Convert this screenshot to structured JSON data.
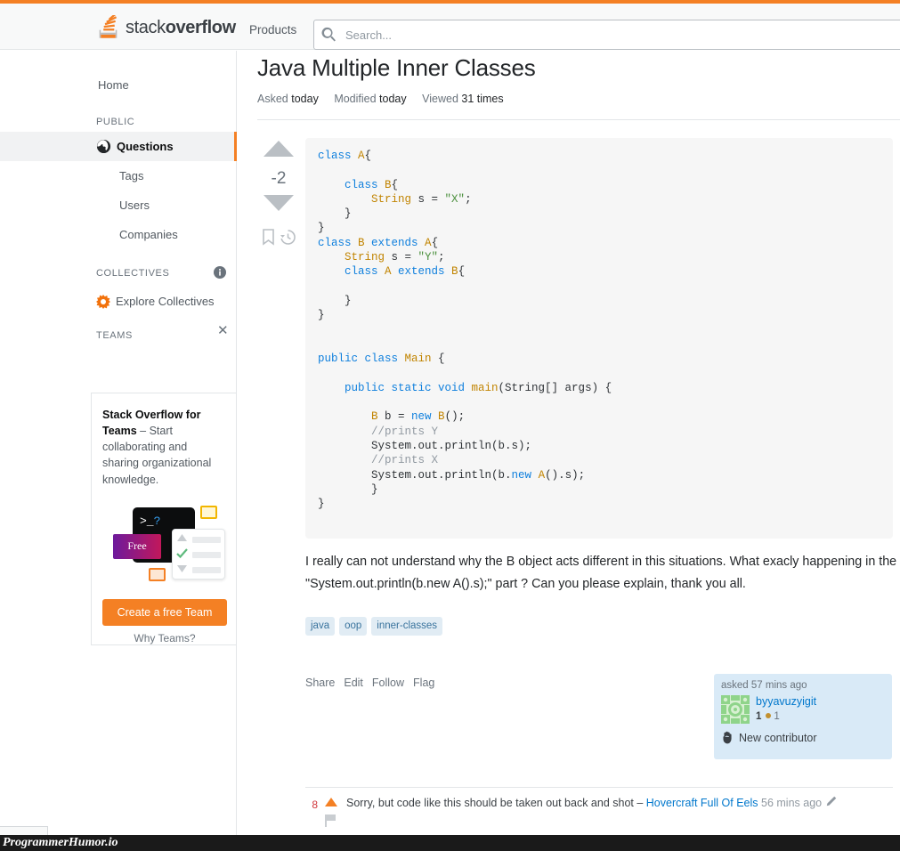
{
  "theme": {
    "accent": "#f48024",
    "link": "#0077cc",
    "tag_bg": "#e1ecf4",
    "tag_fg": "#39739d",
    "usercard_bg": "#d9eaf7",
    "code_bg": "#f6f6f6"
  },
  "header": {
    "logo_text_light": "stack",
    "logo_text_bold": "overflow",
    "products_label": "Products",
    "search": {
      "placeholder": "Search...",
      "value": ""
    }
  },
  "sidebar": {
    "home_label": "Home",
    "public_heading": "PUBLIC",
    "items": [
      {
        "label": "Questions",
        "active": true
      },
      {
        "label": "Tags",
        "active": false
      },
      {
        "label": "Users",
        "active": false
      },
      {
        "label": "Companies",
        "active": false
      }
    ],
    "collectives_heading": "COLLECTIVES",
    "collectives_label": "Explore Collectives",
    "teams_heading": "TEAMS",
    "teams_card": {
      "title": "Stack Overflow for Teams",
      "body": " – Start collaborating and sharing organizational knowledge.",
      "art_prompt": ">_",
      "art_question": "?",
      "art_free_label": "Free",
      "cta_label": "Create a free Team",
      "why_label": "Why Teams?"
    }
  },
  "question": {
    "title": "Java Multiple Inner Classes",
    "meta": {
      "asked_label": "Asked",
      "asked_value": "today",
      "modified_label": "Modified",
      "modified_value": "today",
      "viewed_label": "Viewed",
      "viewed_value": "31 times"
    },
    "votes": "-2",
    "code_lines": [
      [
        {
          "t": "class ",
          "c": "k"
        },
        {
          "t": "A",
          "c": "t"
        },
        {
          "t": "{",
          "c": "p"
        }
      ],
      [],
      [
        {
          "t": "    class ",
          "c": "k"
        },
        {
          "t": "B",
          "c": "t"
        },
        {
          "t": "{",
          "c": "p"
        }
      ],
      [
        {
          "t": "        String",
          "c": "t"
        },
        {
          "t": " s = ",
          "c": "p"
        },
        {
          "t": "\"X\"",
          "c": "s"
        },
        {
          "t": ";",
          "c": "p"
        }
      ],
      [
        {
          "t": "    }",
          "c": "p"
        }
      ],
      [
        {
          "t": "}",
          "c": "p"
        }
      ],
      [
        {
          "t": "class ",
          "c": "k"
        },
        {
          "t": "B",
          "c": "t"
        },
        {
          "t": " extends ",
          "c": "k"
        },
        {
          "t": "A",
          "c": "t"
        },
        {
          "t": "{",
          "c": "p"
        }
      ],
      [
        {
          "t": "    String",
          "c": "t"
        },
        {
          "t": " s = ",
          "c": "p"
        },
        {
          "t": "\"Y\"",
          "c": "s"
        },
        {
          "t": ";",
          "c": "p"
        }
      ],
      [
        {
          "t": "    class ",
          "c": "k"
        },
        {
          "t": "A",
          "c": "t"
        },
        {
          "t": " extends ",
          "c": "k"
        },
        {
          "t": "B",
          "c": "t"
        },
        {
          "t": "{",
          "c": "p"
        }
      ],
      [],
      [
        {
          "t": "    }",
          "c": "p"
        }
      ],
      [
        {
          "t": "}",
          "c": "p"
        }
      ],
      [],
      [],
      [
        {
          "t": "public class ",
          "c": "k"
        },
        {
          "t": "Main",
          "c": "t"
        },
        {
          "t": " {",
          "c": "p"
        }
      ],
      [],
      [
        {
          "t": "    public static void ",
          "c": "k"
        },
        {
          "t": "main",
          "c": "t"
        },
        {
          "t": "(String[] args) {",
          "c": "p"
        }
      ],
      [],
      [
        {
          "t": "        B",
          "c": "t"
        },
        {
          "t": " b = ",
          "c": "p"
        },
        {
          "t": "new ",
          "c": "k"
        },
        {
          "t": "B",
          "c": "t"
        },
        {
          "t": "();",
          "c": "p"
        }
      ],
      [
        {
          "t": "        //prints Y",
          "c": "c"
        }
      ],
      [
        {
          "t": "        System.out.println(b.s);",
          "c": "p"
        }
      ],
      [
        {
          "t": "        //prints X",
          "c": "c"
        }
      ],
      [
        {
          "t": "        System.out.println(b.",
          "c": "p"
        },
        {
          "t": "new ",
          "c": "k"
        },
        {
          "t": "A",
          "c": "t"
        },
        {
          "t": "().s);",
          "c": "p"
        }
      ],
      [
        {
          "t": "        }",
          "c": "p"
        }
      ],
      [
        {
          "t": "}",
          "c": "p"
        }
      ]
    ],
    "body": "I really can not understand why the B object acts different in this situations. What exacly happening in the \"System.out.println(b.new A().s);\" part ? Can you please explain, thank you all.",
    "tags": [
      "java",
      "oop",
      "inner-classes"
    ],
    "actions": [
      "Share",
      "Edit",
      "Follow",
      "Flag"
    ],
    "usercard": {
      "asked_text": "asked 57 mins ago",
      "username": "byyavuzyigit",
      "reputation": "1",
      "badge_count": "1",
      "new_contributor_label": "New contributor"
    },
    "comment": {
      "score": "8",
      "text": "Sorry, but code like this should be taken out back and shot – ",
      "author": "Hovercraft Full Of Eels",
      "time": "56 mins ago"
    }
  },
  "watermark": {
    "label": "ProgrammerHumor.io"
  }
}
